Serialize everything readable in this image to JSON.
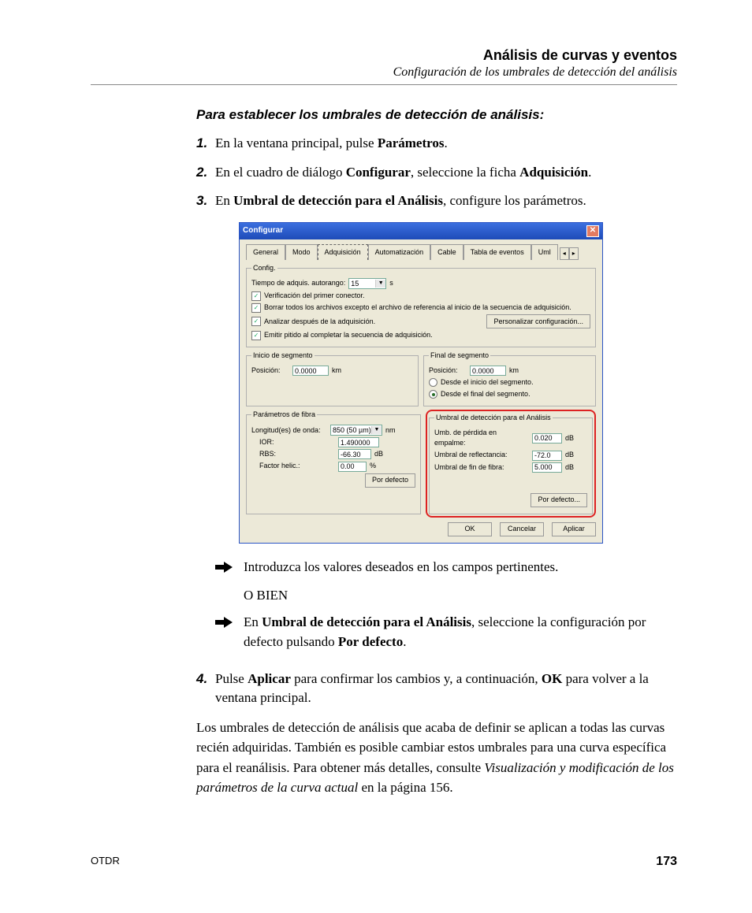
{
  "header": {
    "title": "Análisis de curvas y eventos",
    "subtitle": "Configuración de los umbrales de detección del análisis"
  },
  "subheading": "Para establecer los umbrales de detección de análisis:",
  "steps": {
    "n1": "1.",
    "s1a": "En la ventana principal, pulse ",
    "s1b": "Parámetros",
    "s1c": ".",
    "n2": "2.",
    "s2a": "En el cuadro de diálogo ",
    "s2b": "Configurar",
    "s2c": ", seleccione la ficha ",
    "s2d": "Adquisición",
    "s2e": ".",
    "n3": "3.",
    "s3a": "En ",
    "s3b": "Umbral de detección para el Análisis",
    "s3c": ", configure los parámetros.",
    "bul1": "Introduzca los valores deseados en los campos pertinentes.",
    "orbien": "O BIEN",
    "bul2a": "En ",
    "bul2b": "Umbral de detección para el Análisis",
    "bul2c": ", seleccione la configuración por defecto pulsando ",
    "bul2d": "Por defecto",
    "bul2e": ".",
    "n4": "4.",
    "s4a": "Pulse ",
    "s4b": "Aplicar",
    "s4c": " para confirmar los cambios y, a continuación, ",
    "s4d": "OK",
    "s4e": " para volver a la ventana principal."
  },
  "paragraph": {
    "a": "Los umbrales de detección de análisis que acaba de definir se aplican a todas las curvas recién adquiridas. También es posible cambiar estos umbrales para una curva específica para el reanálisis. Para obtener más detalles, consulte ",
    "b": "Visualización y modificación de los parámetros de la curva actual",
    "c": " en la página 156."
  },
  "footer": {
    "left": "OTDR",
    "page": "173"
  },
  "dlg": {
    "title": "Configurar",
    "tabs": {
      "general": "General",
      "modo": "Modo",
      "adq": "Adquisición",
      "auto": "Automatización",
      "cable": "Cable",
      "tabla": "Tabla de eventos",
      "uml": "Uml"
    },
    "config": {
      "legend": "Config.",
      "tiempo_lbl": "Tiempo de adquis. autorango:",
      "tiempo_val": "15",
      "tiempo_unit": "s",
      "c1": "Verificación del primer conector.",
      "c2": "Borrar todos los archivos excepto el archivo de referencia al inicio de la secuencia de adquisición.",
      "c3": "Analizar después de la adquisición.",
      "c4": "Emitir pitido al completar la secuencia de adquisición.",
      "custom_btn": "Personalizar configuración..."
    },
    "inicio": {
      "legend": "Inicio de segmento",
      "pos_lbl": "Posición:",
      "pos_val": "0.0000",
      "pos_unit": "km"
    },
    "final": {
      "legend": "Final de segmento",
      "pos_lbl": "Posición:",
      "pos_val": "0.0000",
      "pos_unit": "km",
      "r1": "Desde el inicio del segmento.",
      "r2": "Desde el final del segmento."
    },
    "fibra": {
      "legend": "Parámetros de fibra",
      "long_lbl": "Longitud(es) de onda:",
      "long_val": "850 (50 µm)",
      "long_unit": "nm",
      "ior_lbl": "IOR:",
      "ior_val": "1.490000",
      "rbs_lbl": "RBS:",
      "rbs_val": "-66.30",
      "rbs_unit": "dB",
      "helic_lbl": "Factor helic.:",
      "helic_val": "0.00",
      "helic_unit": "%",
      "def_btn": "Por defecto"
    },
    "umbral": {
      "legend": "Umbral de detección para el Análisis",
      "u1_lbl": "Umb. de pérdida en empalme:",
      "u1_val": "0.020",
      "u1_unit": "dB",
      "u2_lbl": "Umbral de reflectancia:",
      "u2_val": "-72.0",
      "u2_unit": "dB",
      "u3_lbl": "Umbral de fin de fibra:",
      "u3_val": "5.000",
      "u3_unit": "dB",
      "def_btn": "Por defecto..."
    },
    "btns": {
      "ok": "OK",
      "cancel": "Cancelar",
      "apply": "Aplicar"
    }
  }
}
